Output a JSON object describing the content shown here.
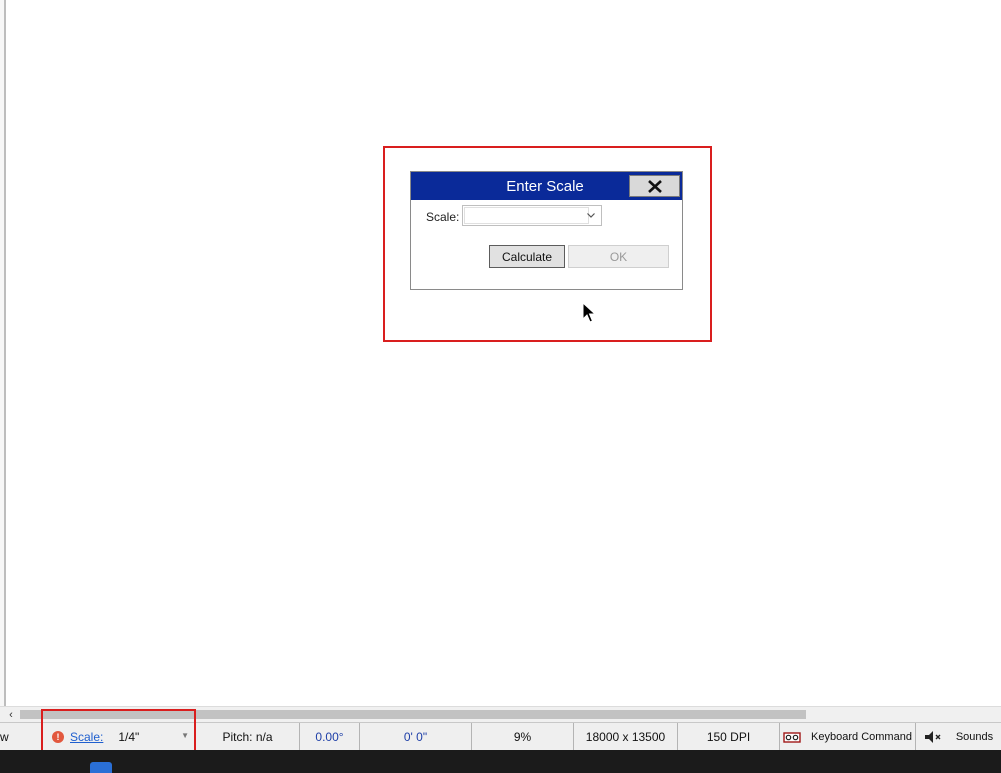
{
  "dialog": {
    "title": "Enter Scale",
    "close_label": "X",
    "scale_label": "Scale:",
    "scale_value": "",
    "calculate_label": "Calculate",
    "ok_label": "OK"
  },
  "statusbar": {
    "left_fragment": "w",
    "scale_link": "Scale:",
    "scale_value": "1/4\"",
    "pitch": "Pitch: n/a",
    "angle": "0.00°",
    "length": "0' 0\"",
    "zoom": "9%",
    "dimensions": "18000 x 13500",
    "dpi": "150 DPI",
    "keyboard_command": "Keyboard Command",
    "sounds": "Sounds"
  },
  "colors": {
    "title_bar": "#0a2a99",
    "highlight": "#d91e1e",
    "link": "#1f5fcf"
  },
  "icons": {
    "close": "close-icon",
    "dropdown": "chevron-down-icon",
    "status": "status-dot-icon",
    "keyboard": "keyboard-icon",
    "sound": "speaker-mute-icon",
    "cursor": "mouse-cursor-icon"
  }
}
